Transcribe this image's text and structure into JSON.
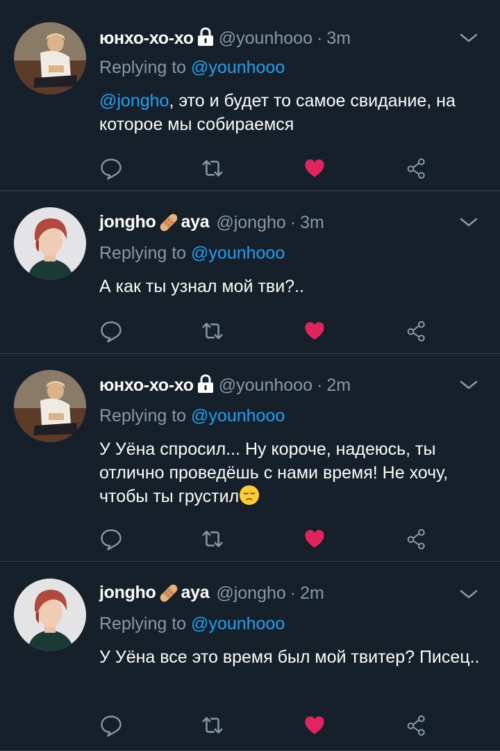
{
  "colors": {
    "background": "#15202b",
    "divider": "#38444d",
    "text": "#ffffff",
    "muted": "#8899a6",
    "link": "#1da1f2",
    "like": "#e0245e"
  },
  "tweets": [
    {
      "display_name": "юнхо-хо-хо",
      "name_badge": "lock-icon",
      "handle": "@younhooo",
      "separator": "·",
      "time": "3m",
      "replying_prefix": "Replying to",
      "replying_to": "@younhooo",
      "mention": "@jongho",
      "text": ", это и будет то самое свидание, на которое мы собираемся",
      "liked": true
    },
    {
      "display_name_start": "jongho",
      "name_badge": "bandage-emoji-icon",
      "display_name_end": "aya",
      "handle": "@jongho",
      "separator": "·",
      "time": "3m",
      "replying_prefix": "Replying to",
      "replying_to": "@younhooo",
      "text": "А как ты узнал мой тви?..",
      "liked": true
    },
    {
      "display_name": "юнхо-хо-хо",
      "name_badge": "lock-icon",
      "handle": "@younhooo",
      "separator": "·",
      "time": "2m",
      "replying_prefix": "Replying to",
      "replying_to": "@younhooo",
      "text": "У Уёна спросил... Ну короче, надеюсь, ты отлично проведёшь с нами время! Не хочу, чтобы ты грустил",
      "trailing_emoji": "pensive-face-icon",
      "liked": true
    },
    {
      "display_name_start": "jongho",
      "name_badge": "bandage-emoji-icon",
      "display_name_end": "aya",
      "handle": "@jongho",
      "separator": "·",
      "time": "2m",
      "replying_prefix": "Replying to",
      "replying_to": "@younhooo",
      "text": "У Уёна все это время был мой твитер? Писец..",
      "liked": true
    }
  ]
}
